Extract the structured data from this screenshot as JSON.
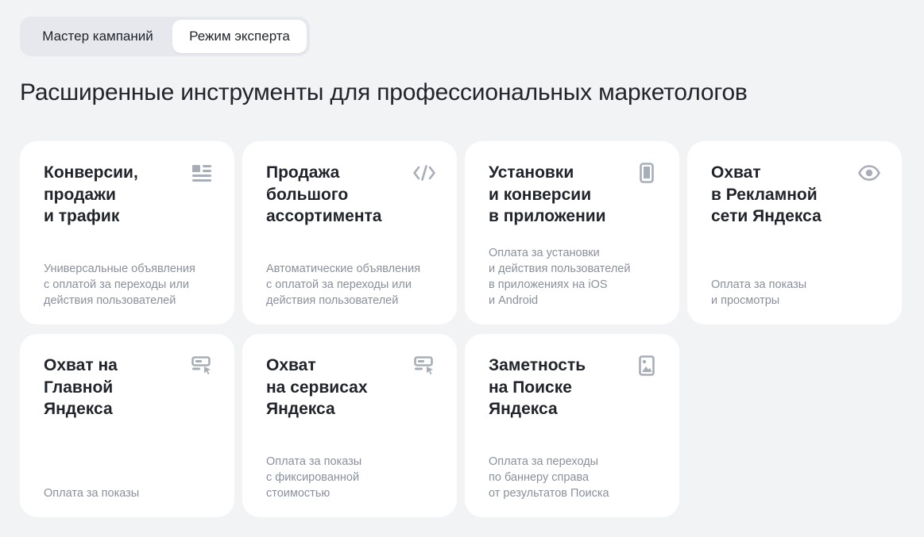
{
  "mode_switch": {
    "master_label": "Мастер кампаний",
    "expert_label": "Режим эксперта",
    "selected": "expert"
  },
  "page": {
    "title": "Расширенные инструменты для профессиональных маркетологов"
  },
  "colors": {
    "background": "#f2f3f5",
    "card": "#ffffff",
    "text": "#21252b",
    "muted": "#8a909b",
    "icon": "#a8aeb8"
  },
  "cards": [
    {
      "title": "Конверсии,\nпродажи\nи трафик",
      "description": "Универсальные объявления\nс оплатой за переходы или\nдействия пользователей",
      "icon": "text-lines-icon"
    },
    {
      "title": "Продажа\nбольшого\nассортимента",
      "description": "Автоматические объявления\nс оплатой за переходы или\nдействия пользователей",
      "icon": "code-icon"
    },
    {
      "title": "Установки\nи конверсии\nв приложении",
      "description": "Оплата за установки\nи действия пользователей\nв приложениях на iOS\nи Android",
      "icon": "smartphone-icon"
    },
    {
      "title": "Охват\nв Рекламной\nсети Яндекса",
      "description": "Оплата за показы\nи просмотры",
      "icon": "eye-icon"
    },
    {
      "title": "Охват на\nГлавной\nЯндекса",
      "description": "Оплата за показы",
      "icon": "banner-click-icon"
    },
    {
      "title": "Охват\nна сервисах\nЯндекса",
      "description": "Оплата за показы\nс фиксированной\nстоимостью",
      "icon": "banner-click-icon"
    },
    {
      "title": "Заметность\nна Поиске\nЯндекса",
      "description": "Оплата за переходы\nпо баннеру справа\nот результатов Поиска",
      "icon": "image-banner-icon"
    }
  ]
}
